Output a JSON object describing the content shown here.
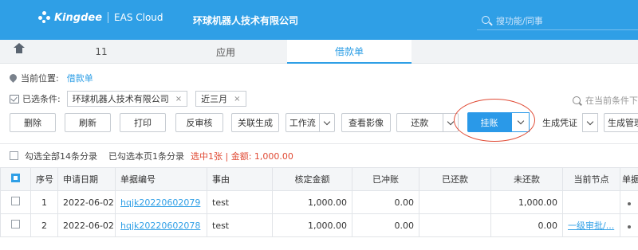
{
  "header": {
    "brand": "Kingdee",
    "product": "EAS Cloud",
    "company": "环球机器人技术有限公司",
    "search_placeholder": "搜功能/同事",
    "background": "#2f9fe6"
  },
  "tabs": [
    {
      "label": "11",
      "active": false
    },
    {
      "label": "应用",
      "active": false
    },
    {
      "label": "借款单",
      "active": true
    }
  ],
  "location": {
    "label": "当前位置:",
    "value": "借款单"
  },
  "conditions": {
    "label": "已选条件:",
    "chips": [
      {
        "text": "环球机器人技术有限公司",
        "close": "×"
      },
      {
        "text": "近三月",
        "close": "×"
      }
    ],
    "search_placeholder": "在当前条件下"
  },
  "toolbar": {
    "delete": "删除",
    "refresh": "刷新",
    "print": "打印",
    "unaudit": "反审核",
    "link_generate": "关联生成",
    "workflow": "工作流",
    "view_image": "查看影像",
    "repay": "还款",
    "hang_account": "挂账",
    "gen_voucher": "生成凭证",
    "gen_manage": "生成管理"
  },
  "summary": {
    "check_all": "勾选全部14条分录",
    "page_selected": "已勾选本页1条分录",
    "selected_info": "选中1张 | 金额: 1,000.00"
  },
  "table": {
    "columns": [
      "序号",
      "申请日期",
      "单据编号",
      "事由",
      "核定金额",
      "已冲账",
      "已还款",
      "未还款",
      "当前节点",
      "单据"
    ],
    "rows": [
      {
        "no": "1",
        "date": "2022-06-02",
        "number": "hqjk20220602079",
        "reason": "test",
        "approved": "1,000.00",
        "offset": "0.00",
        "repaid": "",
        "unpaid": "1,000.00",
        "node": ""
      },
      {
        "no": "2",
        "date": "2022-06-02",
        "number": "hqjk20220602078",
        "reason": "test",
        "approved": "1,000.00",
        "offset": "0.00",
        "repaid": "",
        "unpaid": "0.00",
        "node": "一级审批/..."
      }
    ]
  }
}
